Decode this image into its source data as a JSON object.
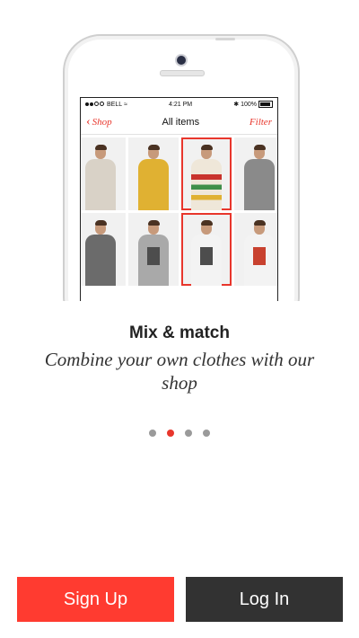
{
  "phone": {
    "status": {
      "carrier": "BELL",
      "time": "4:21 PM",
      "battery": "100%"
    },
    "nav": {
      "back_label": "Shop",
      "title": "All items",
      "filter_label": "Filter"
    },
    "products": [
      {
        "shirt": "#d9d2c7",
        "print": "none",
        "selected": false
      },
      {
        "shirt": "#e0b132",
        "print": "none",
        "selected": false
      },
      {
        "shirt": "#efe7d9",
        "print": "stripes",
        "selected": true
      },
      {
        "shirt": "#8a8a8a",
        "print": "none",
        "selected": false
      },
      {
        "shirt": "#6b6b6b",
        "print": "none",
        "selected": false
      },
      {
        "shirt": "#a9a9a9",
        "print": "graphic",
        "selected": false
      },
      {
        "shirt": "#f3f3f3",
        "print": "graphic",
        "selected": true
      },
      {
        "shirt": "#f3f3f3",
        "print": "red-graphic",
        "selected": false
      }
    ]
  },
  "onboarding": {
    "title": "Mix & match",
    "subtitle": "Combine your own clothes with our shop",
    "pages": 4,
    "active_page": 2
  },
  "buttons": {
    "sign_up": "Sign Up",
    "log_in": "Log In"
  },
  "colors": {
    "accent": "#ff3b30",
    "dark_button": "#323232",
    "pager_inactive": "#9a9a9a"
  }
}
